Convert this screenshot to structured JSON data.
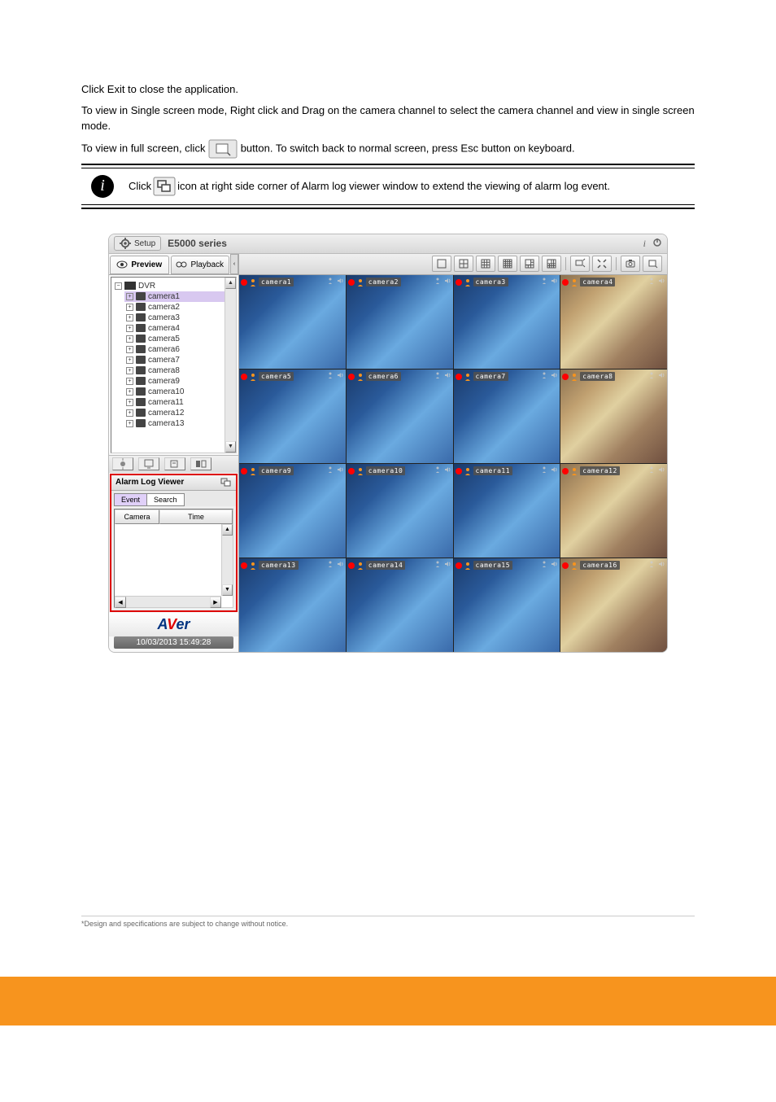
{
  "body_text_1": "Click Exit to close the application.",
  "body_text_2": "To view in Single screen mode, Right click and Drag on the camera channel to select the camera channel and view in single screen mode.",
  "body_text_3_pre": "To view in full screen, click ",
  "body_text_3_post": " button. To switch back to normal screen, press Esc button on keyboard.",
  "info_text_pre": "Click ",
  "info_text_post": " icon at right side corner of Alarm log viewer window to extend the viewing of alarm log event.",
  "app": {
    "setup_label": "Setup",
    "series_label": "E5000 series",
    "info_icon_tip": "i",
    "power_icon_tip": "⏻"
  },
  "tabs": {
    "preview": "Preview",
    "playback": "Playback"
  },
  "tree": {
    "root": "DVR",
    "cameras": [
      "camera1",
      "camera2",
      "camera3",
      "camera4",
      "camera5",
      "camera6",
      "camera7",
      "camera8",
      "camera9",
      "camera10",
      "camera11",
      "camera12",
      "camera13"
    ],
    "selected": "camera1"
  },
  "alarm": {
    "title": "Alarm Log Viewer",
    "tab_event": "Event",
    "tab_search": "Search",
    "col_camera": "Camera",
    "col_time": "Time"
  },
  "logo": {
    "a": "A",
    "v": "V",
    "er": "er"
  },
  "datetime": "10/03/2013 15:49:28",
  "grid_cameras": [
    {
      "label": "camera1",
      "store": false
    },
    {
      "label": "camera2",
      "store": false
    },
    {
      "label": "camera3",
      "store": false
    },
    {
      "label": "camera4",
      "store": true
    },
    {
      "label": "camera5",
      "store": false
    },
    {
      "label": "camera6",
      "store": false
    },
    {
      "label": "camera7",
      "store": false
    },
    {
      "label": "camera8",
      "store": true
    },
    {
      "label": "camera9",
      "store": false
    },
    {
      "label": "camera10",
      "store": false
    },
    {
      "label": "camera11",
      "store": false
    },
    {
      "label": "camera12",
      "store": true
    },
    {
      "label": "camera13",
      "store": false
    },
    {
      "label": "camera14",
      "store": false
    },
    {
      "label": "camera15",
      "store": false
    },
    {
      "label": "camera16",
      "store": true
    }
  ],
  "footnote": "*Design and specifications are subject to change without notice."
}
